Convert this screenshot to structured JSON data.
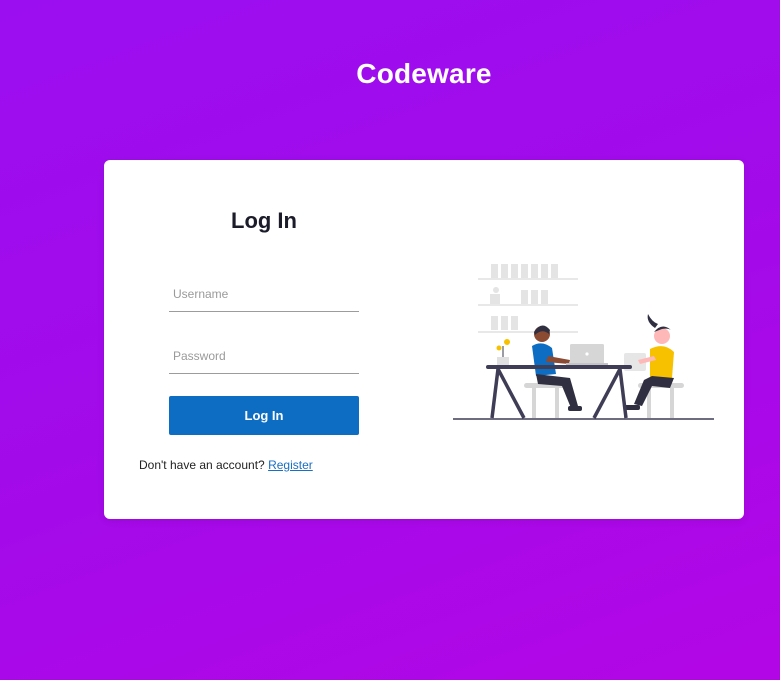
{
  "brand": {
    "title": "Codeware"
  },
  "login": {
    "heading": "Log In",
    "username_placeholder": "Username",
    "password_placeholder": "Password",
    "submit_label": "Log In",
    "register_prompt": "Don't have an account?",
    "register_link": "Register"
  },
  "colors": {
    "background_start": "#9b0ef0",
    "background_end": "#b306e6",
    "button": "#0d6dc3",
    "link": "#1a6fc0"
  }
}
